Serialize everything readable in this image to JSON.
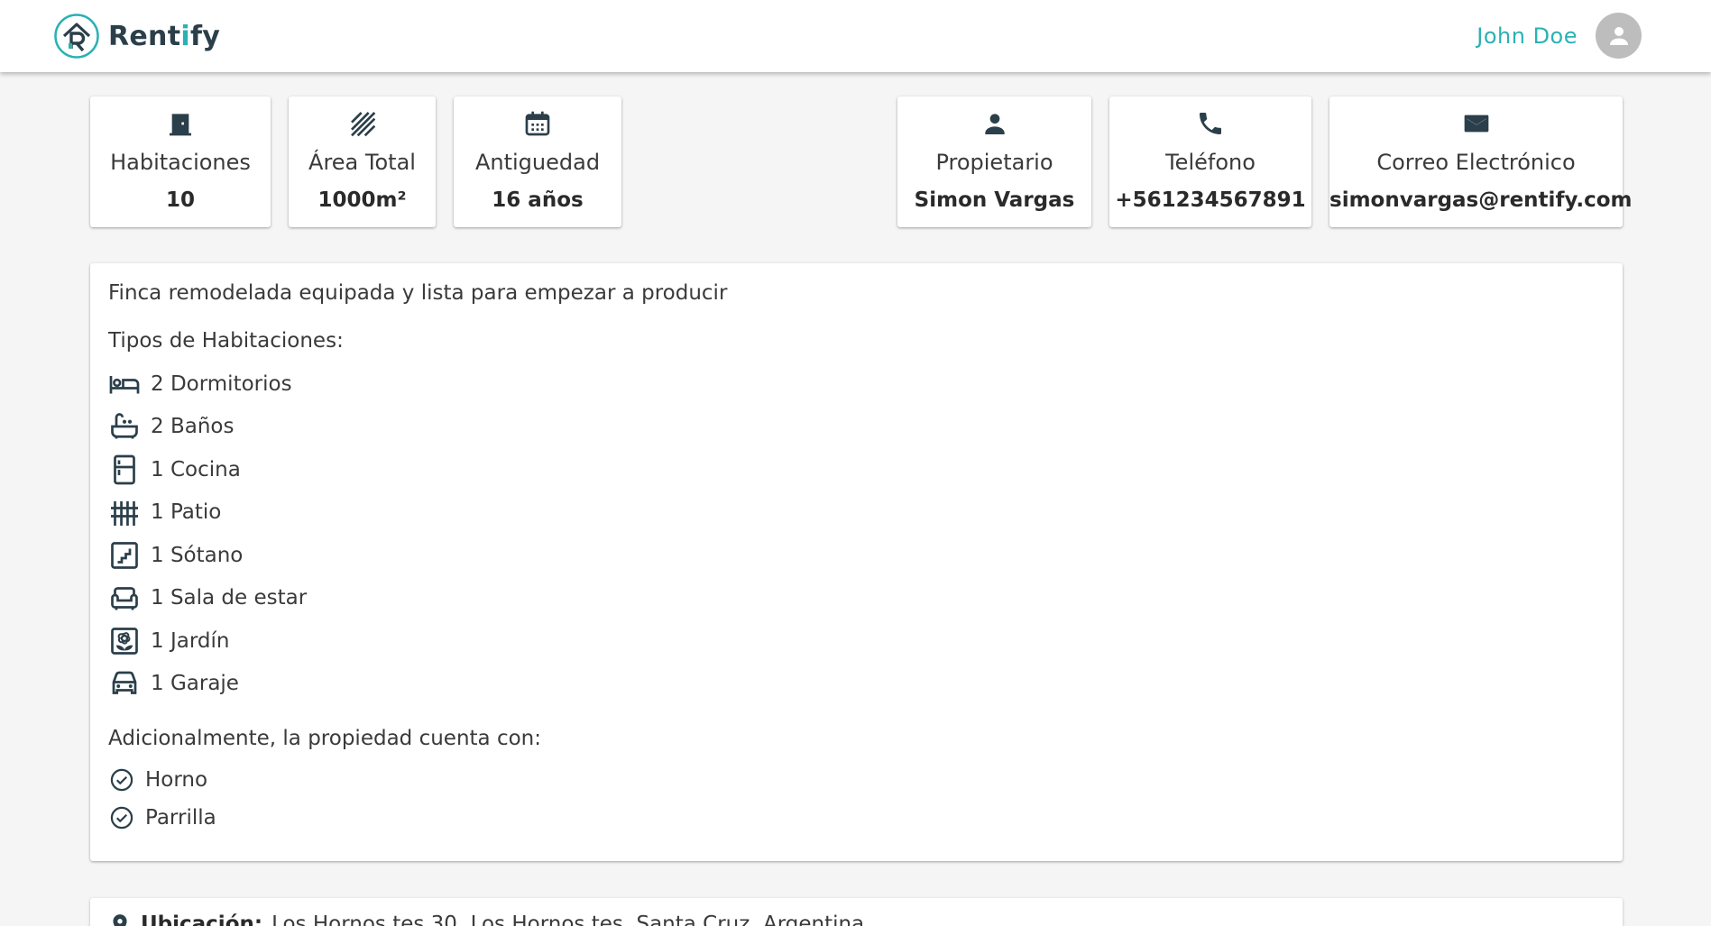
{
  "app": {
    "brand_prefix": "Rent",
    "brand_accent": "i",
    "brand_suffix": "fy",
    "user_name": "John Doe"
  },
  "colors": {
    "accent": "#2bb1b4",
    "logo_dark": "#2b3f4a",
    "icon": "#2b3f4a"
  },
  "stats": [
    {
      "icon": "door-icon",
      "label": "Habitaciones",
      "value": "10"
    },
    {
      "icon": "texture-icon",
      "label": "Área Total",
      "value": "1000m²"
    },
    {
      "icon": "calendar-icon",
      "label": "Antiguedad",
      "value": "16 años"
    }
  ],
  "owner": [
    {
      "icon": "person-icon",
      "label": "Propietario",
      "value": "Simon Vargas"
    },
    {
      "icon": "phone-icon",
      "label": "Teléfono",
      "value": "+561234567891"
    },
    {
      "icon": "mail-icon",
      "label": "Correo Electrónico",
      "value": "simonvargas@rentify.com"
    }
  ],
  "details": {
    "description": "Finca remodelada equipada y lista para empezar a producir",
    "room_types_title": "Tipos de Habitaciones:",
    "rooms": [
      {
        "icon": "bed-icon",
        "label": "2 Dormitorios"
      },
      {
        "icon": "bathtub-icon",
        "label": "2 Baños"
      },
      {
        "icon": "fridge-icon",
        "label": "1 Cocina"
      },
      {
        "icon": "fence-icon",
        "label": "1 Patio"
      },
      {
        "icon": "stairs-icon",
        "label": "1 Sótano"
      },
      {
        "icon": "sofa-icon",
        "label": "1 Sala de estar"
      },
      {
        "icon": "garden-icon",
        "label": "1 Jardín"
      },
      {
        "icon": "car-icon",
        "label": "1 Garaje"
      }
    ],
    "extras_title": "Adicionalmente, la propiedad cuenta con:",
    "extras": [
      "Horno",
      "Parrilla"
    ]
  },
  "location": {
    "label": "Ubicación:",
    "value": "Los Hornos tes 30, Los Hornos tes, Santa Cruz, Argentina"
  }
}
